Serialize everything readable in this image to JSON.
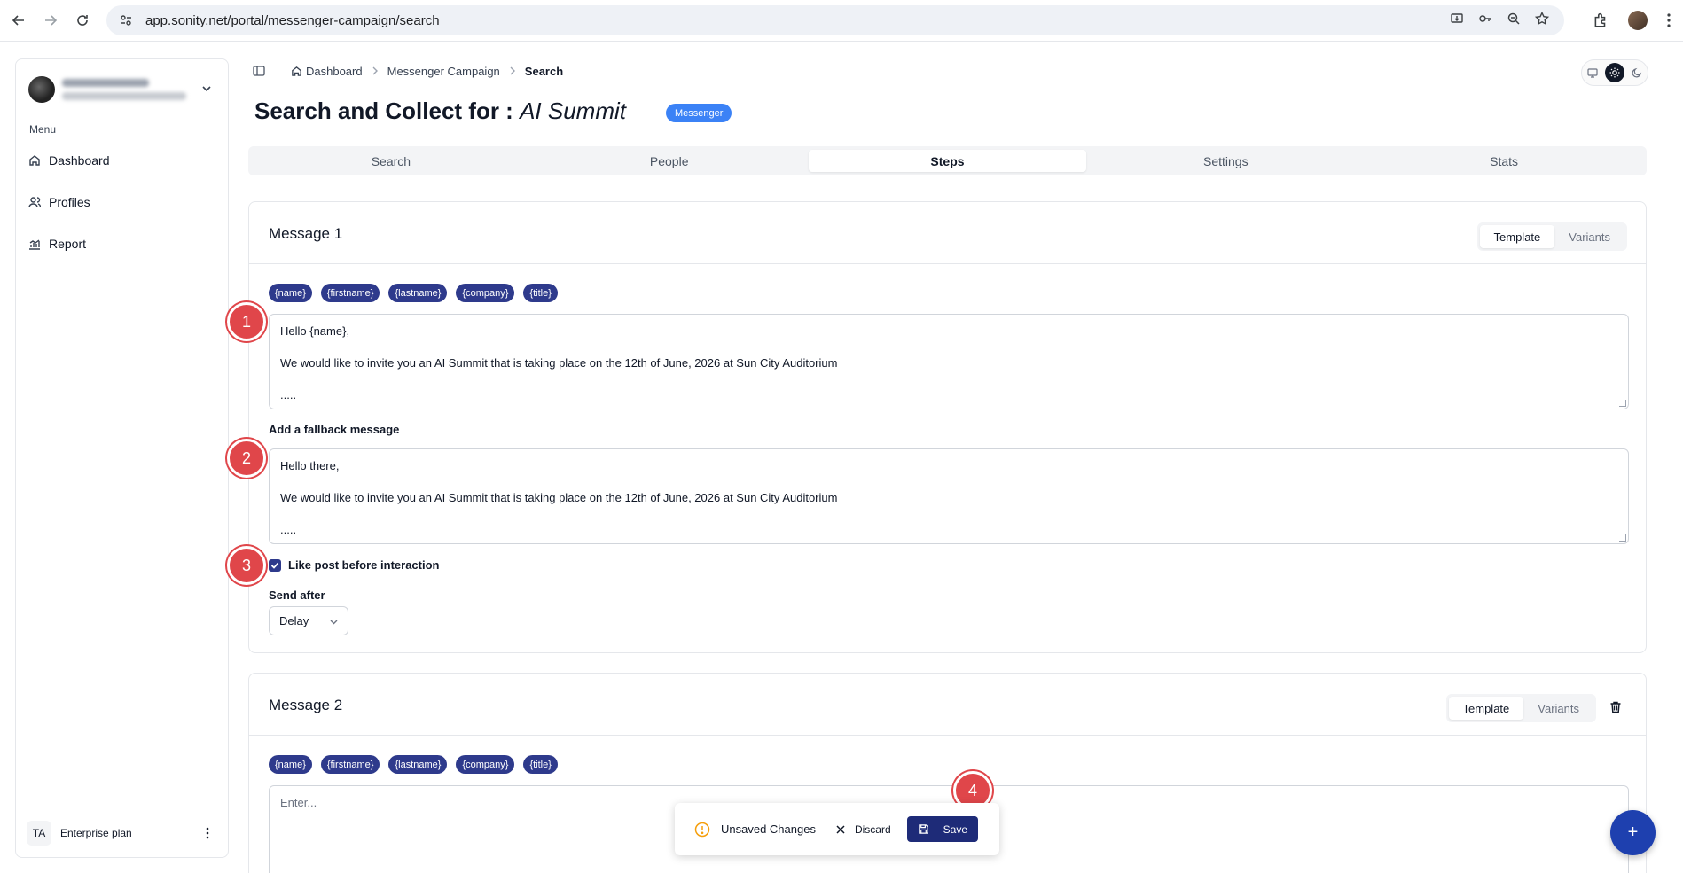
{
  "browser": {
    "url": "app.sonity.net/portal/messenger-campaign/search"
  },
  "sidebar": {
    "menu_label": "Menu",
    "items": [
      {
        "label": "Dashboard",
        "icon": "home-icon"
      },
      {
        "label": "Profiles",
        "icon": "users-icon"
      },
      {
        "label": "Report",
        "icon": "chart-icon"
      }
    ],
    "footer": {
      "initials": "TA",
      "plan": "Enterprise plan"
    }
  },
  "breadcrumb": {
    "items": [
      "Dashboard",
      "Messenger Campaign"
    ],
    "current": "Search"
  },
  "header": {
    "title_prefix": "Search and Collect for : ",
    "title_name": "AI Summit",
    "badge": "Messenger"
  },
  "tabs": [
    {
      "label": "Search",
      "active": false
    },
    {
      "label": "People",
      "active": false
    },
    {
      "label": "Steps",
      "active": true
    },
    {
      "label": "Settings",
      "active": false
    },
    {
      "label": "Stats",
      "active": false
    }
  ],
  "variables": [
    "{name}",
    "{firstname}",
    "{lastname}",
    "{company}",
    "{title}"
  ],
  "message1": {
    "title": "Message 1",
    "seg_template": "Template",
    "seg_variants": "Variants",
    "body_lines": [
      "Hello {name},",
      "We would like to invite you an AI Summit that is taking place on the 12th of June, 2026 at Sun City Auditorium",
      "....."
    ],
    "fallback_label": "Add a fallback message",
    "fallback_lines": [
      "Hello there,",
      "We would like to invite you an AI Summit that is taking place on the 12th of June, 2026 at Sun City Auditorium",
      "....."
    ],
    "like_post_label": "Like post before interaction",
    "like_post_checked": true,
    "send_after_label": "Send after",
    "send_after_value": "Delay"
  },
  "message2": {
    "title": "Message 2",
    "seg_template": "Template",
    "seg_variants": "Variants",
    "placeholder": "Enter..."
  },
  "unsaved_bar": {
    "text": "Unsaved Changes",
    "discard": "Discard",
    "save": "Save"
  },
  "markers": [
    "1",
    "2",
    "3",
    "4"
  ],
  "fab_label": "+",
  "colors": {
    "accent": "#1e2b78",
    "chip": "#2e3a8c",
    "badge": "#3b82f6",
    "marker": "#e0464a"
  }
}
